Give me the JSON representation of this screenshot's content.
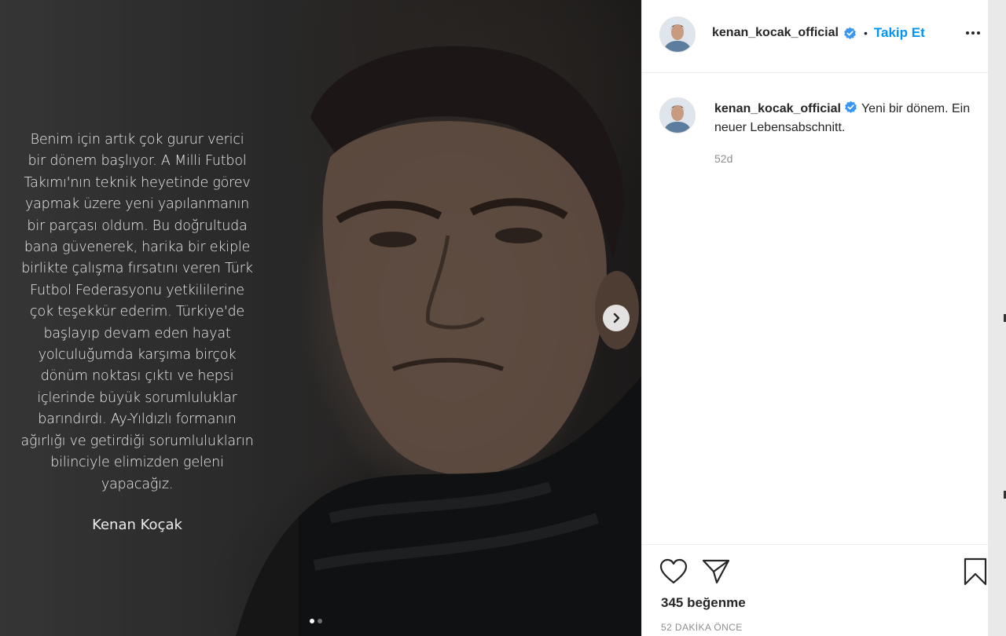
{
  "post": {
    "image": {
      "quote_lines": [
        "Benim için artık çok gurur verici",
        "bir dönem başlıyor. A Milli Futbol",
        "Takımı'nın teknik heyetinde görev",
        "yapmak üzere yeni yapılanmanın",
        "bir parçası oldum. Bu doğrultuda",
        "bana güvenerek, harika bir ekiple",
        "birlikte çalışma fırsatını veren Türk",
        "Futbol Federasyonu yetkililerine",
        "çok teşekkür ederim. Türkiye'de",
        "başlayıp devam eden hayat",
        "yolculuğumda karşıma birçok",
        "dönüm noktası çıktı ve hepsi",
        "içlerinde büyük sorumluluklar",
        "barındırdı. Ay-Yıldızlı formanın",
        "ağırlığı ve getirdiği sorumlulukların",
        "bilinciyle elimizden geleni",
        "yapacağız."
      ],
      "signature": "Kenan Koçak",
      "carousel_total": 2,
      "carousel_active": 1
    },
    "header": {
      "username": "kenan_kocak_official",
      "separator": "•",
      "follow_label": "Takip Et"
    },
    "caption": {
      "username": "kenan_kocak_official",
      "text": "Yeni bir dönem. Ein neuer Lebensabschnitt.",
      "time": "52d"
    },
    "likes": "345 beğenme",
    "posted_ago": "52 DAKİKA ÖNCE"
  },
  "colors": {
    "accent": "#0095f6",
    "verified": "#3897f0",
    "text_primary": "#262626",
    "text_secondary": "#8e8e8e"
  },
  "icons": [
    "chevron-right-icon",
    "verified-badge-icon",
    "more-options-icon",
    "heart-icon",
    "share-icon",
    "bookmark-icon"
  ]
}
